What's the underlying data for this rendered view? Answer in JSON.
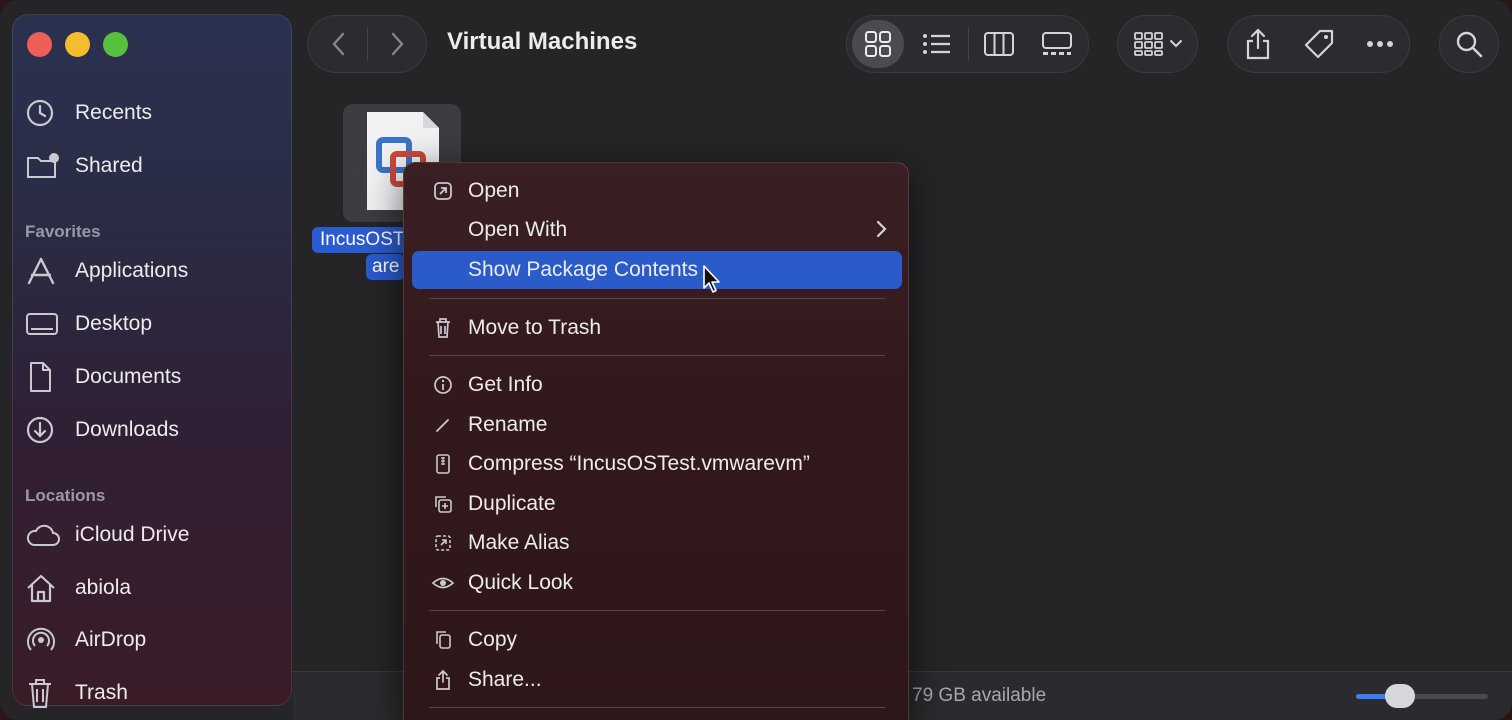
{
  "window": {
    "title": "Virtual Machines"
  },
  "sidebar": {
    "items_top": [
      {
        "label": "Recents",
        "icon": "clock-icon"
      },
      {
        "label": "Shared",
        "icon": "shared-folder-icon"
      }
    ],
    "favorites_header": "Favorites",
    "favorites": [
      {
        "label": "Applications",
        "icon": "applications-icon"
      },
      {
        "label": "Desktop",
        "icon": "desktop-icon"
      },
      {
        "label": "Documents",
        "icon": "document-icon"
      },
      {
        "label": "Downloads",
        "icon": "download-icon"
      }
    ],
    "locations_header": "Locations",
    "locations": [
      {
        "label": "iCloud Drive",
        "icon": "cloud-icon"
      },
      {
        "label": "abiola",
        "icon": "home-icon"
      },
      {
        "label": "AirDrop",
        "icon": "airdrop-icon"
      },
      {
        "label": "Trash",
        "icon": "trash-icon"
      }
    ]
  },
  "file": {
    "label_line1": "IncusOST",
    "label_line2": "are"
  },
  "context_menu": {
    "items": [
      {
        "label": "Open",
        "icon": "open-icon"
      },
      {
        "label": "Open With",
        "icon": "",
        "submenu": "›"
      },
      {
        "label": "Show Package Contents",
        "icon": "",
        "highlighted": true
      },
      {
        "label": "Move to Trash",
        "icon": "trash-icon"
      },
      {
        "label": "Get Info",
        "icon": "info-icon"
      },
      {
        "label": "Rename",
        "icon": "pencil-icon"
      },
      {
        "label": "Compress “IncusOSTest.vmwarevm”",
        "icon": "compress-icon"
      },
      {
        "label": "Duplicate",
        "icon": "duplicate-icon"
      },
      {
        "label": "Make Alias",
        "icon": "alias-icon"
      },
      {
        "label": "Quick Look",
        "icon": "eye-icon"
      },
      {
        "label": "Copy",
        "icon": "copy-icon"
      },
      {
        "label": "Share...",
        "icon": "share-icon"
      }
    ]
  },
  "status": {
    "available": "79 GB available"
  },
  "icon_size_slider": {
    "level": 0.28
  },
  "colors": {
    "highlight": "#2a5bc8",
    "accent": "#3b7bf5"
  }
}
